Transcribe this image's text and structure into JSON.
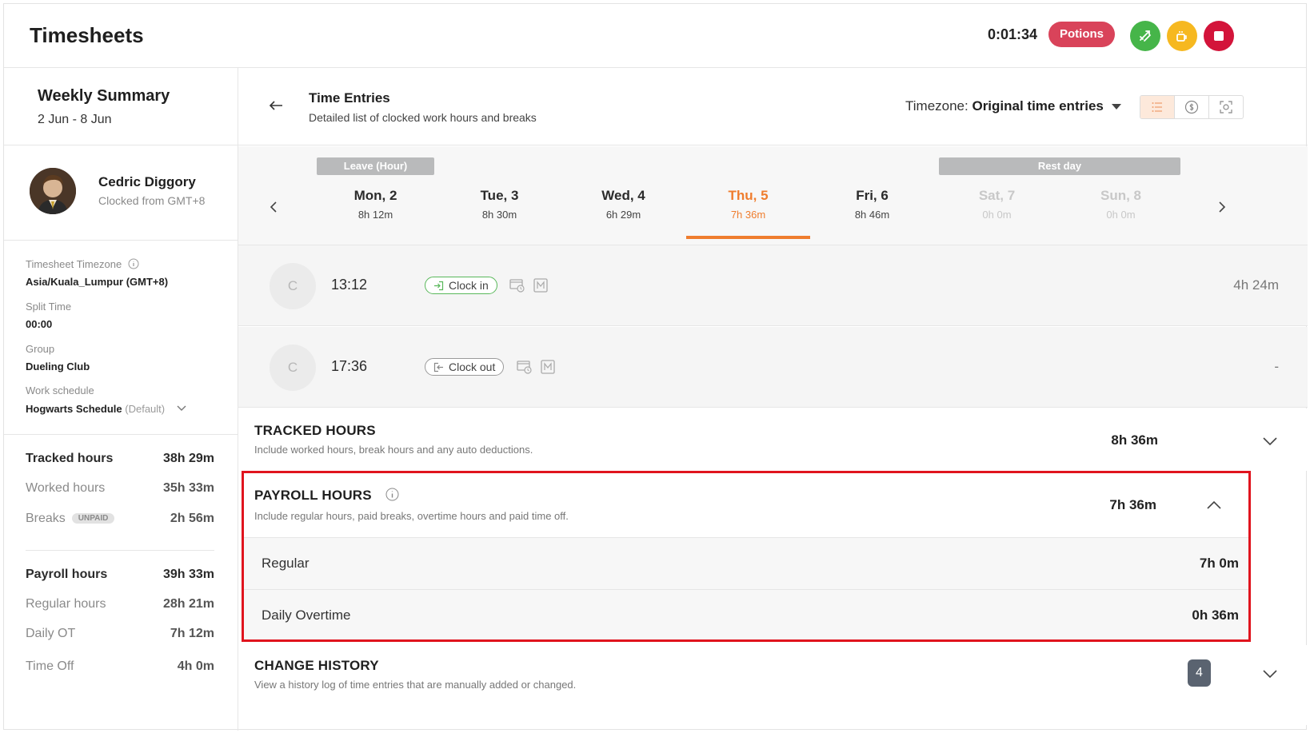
{
  "header": {
    "title": "Timesheets",
    "timer": "0:01:34",
    "activity_label": "Potions",
    "colors": {
      "activity": "#d9435a",
      "switch": "#46b549",
      "break": "#f6b820",
      "stop": "#d3143a"
    }
  },
  "summary": {
    "title": "Weekly Summary",
    "range": "2 Jun - 8 Jun"
  },
  "user": {
    "name": "Cedric Diggory",
    "clocked_from": "Clocked from GMT+8"
  },
  "settings": {
    "timezone_label": "Timesheet Timezone",
    "timezone_value": "Asia/Kuala_Lumpur (GMT+8)",
    "split_label": "Split Time",
    "split_value": "00:00",
    "group_label": "Group",
    "group_value": "Dueling Club",
    "schedule_label": "Work schedule",
    "schedule_value": "Hogwarts Schedule",
    "schedule_suffix": "(Default)"
  },
  "stats": {
    "tracked": {
      "label": "Tracked hours",
      "value": "38h 29m"
    },
    "worked": {
      "label": "Worked hours",
      "value": "35h 33m"
    },
    "breaks": {
      "label": "Breaks",
      "badge": "UNPAID",
      "value": "2h 56m"
    },
    "payroll": {
      "label": "Payroll hours",
      "value": "39h 33m"
    },
    "regular": {
      "label": "Regular hours",
      "value": "28h 21m"
    },
    "daily_ot": {
      "label": "Daily OT",
      "value": "7h 12m"
    },
    "time_off": {
      "label": "Time Off",
      "value": "4h 0m"
    }
  },
  "entries_header": {
    "title": "Time Entries",
    "subtitle": "Detailed list of clocked work hours and breaks",
    "timezone_prefix": "Timezone: ",
    "timezone_value": "Original time entries"
  },
  "ribbons": {
    "leave": "Leave (Hour)",
    "rest": "Rest day"
  },
  "days": [
    {
      "name": "Mon, 2",
      "hours": "8h 12m",
      "state": "normal"
    },
    {
      "name": "Tue, 3",
      "hours": "8h 30m",
      "state": "normal"
    },
    {
      "name": "Wed, 4",
      "hours": "6h 29m",
      "state": "normal"
    },
    {
      "name": "Thu, 5",
      "hours": "7h 36m",
      "state": "active"
    },
    {
      "name": "Fri, 6",
      "hours": "8h 46m",
      "state": "normal"
    },
    {
      "name": "Sat, 7",
      "hours": "0h 0m",
      "state": "muted"
    },
    {
      "name": "Sun, 8",
      "hours": "0h 0m",
      "state": "muted"
    }
  ],
  "entries": [
    {
      "initial": "C",
      "time": "13:12",
      "action": "Clock in",
      "duration": "4h 24m"
    },
    {
      "initial": "C",
      "time": "17:36",
      "action": "Clock out",
      "duration": "-"
    }
  ],
  "tracked_hours": {
    "title": "TRACKED HOURS",
    "subtitle": "Include worked hours, break hours and any auto deductions.",
    "value": "8h 36m"
  },
  "payroll_hours": {
    "title": "PAYROLL HOURS",
    "subtitle": "Include regular hours, paid breaks, overtime hours and paid time off.",
    "value": "7h 36m",
    "rows": [
      {
        "label": "Regular",
        "value": "7h 0m"
      },
      {
        "label": "Daily Overtime",
        "value": "0h 36m"
      }
    ]
  },
  "change_history": {
    "title": "CHANGE HISTORY",
    "subtitle": "View a history log of time entries that are manually added or changed.",
    "count": "4"
  }
}
